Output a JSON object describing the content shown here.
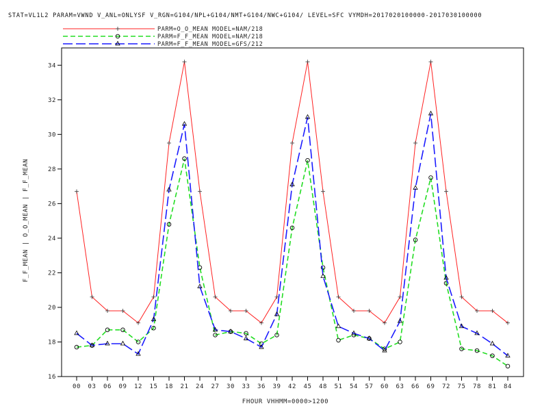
{
  "chart_data": {
    "type": "line",
    "title": "STAT=VL1L2 PARAM=VWND V_ANL=ONLYSF V_RGN=G104/NPL+G104/NMT+G104/NWC+G104/ LEVEL=SFC VYMDH=2017020100000-2017030100000",
    "xlabel": "FHOUR VHHMM=0000>1200",
    "ylabel": "F_F_MEAN | O_O_MEAN | F_F_MEAN",
    "ylim": [
      16,
      35
    ],
    "yticks": [
      "16",
      "18",
      "20",
      "22",
      "24",
      "26",
      "28",
      "30",
      "32",
      "34"
    ],
    "ytick_values": [
      16,
      18,
      20,
      22,
      24,
      26,
      28,
      30,
      32,
      34
    ],
    "categories": [
      "00",
      "03",
      "06",
      "09",
      "12",
      "15",
      "18",
      "21",
      "24",
      "27",
      "30",
      "33",
      "36",
      "39",
      "42",
      "45",
      "48",
      "51",
      "54",
      "57",
      "60",
      "63",
      "66",
      "69",
      "72",
      "75",
      "78",
      "81",
      "84"
    ],
    "grid": false,
    "legend_position": "top-left",
    "series": [
      {
        "name": "PARM=O_O_MEAN MODEL=NAM/218",
        "color": "#ff2020",
        "dash": "solid",
        "marker": "plus",
        "values": [
          26.7,
          20.6,
          19.8,
          19.8,
          19.1,
          20.6,
          29.5,
          34.2,
          26.7,
          20.6,
          19.8,
          19.8,
          19.1,
          20.6,
          29.5,
          34.2,
          26.7,
          20.6,
          19.8,
          19.8,
          19.1,
          20.6,
          29.5,
          34.2,
          26.7,
          20.6,
          19.8,
          19.8,
          19.1
        ]
      },
      {
        "name": "PARM=F_F_MEAN MODEL=NAM/218",
        "color": "#22dd22",
        "dash": "dashed",
        "marker": "circle",
        "values": [
          17.7,
          17.8,
          18.7,
          18.7,
          18.0,
          18.8,
          24.8,
          28.6,
          22.3,
          18.4,
          18.6,
          18.5,
          17.9,
          18.4,
          24.6,
          28.5,
          22.3,
          18.1,
          18.4,
          18.2,
          17.6,
          18.0,
          23.9,
          27.5,
          21.4,
          17.6,
          17.5,
          17.2,
          16.6
        ]
      },
      {
        "name": "PARM=F_F_MEAN MODEL=GFS/212",
        "color": "#1a1aff",
        "dash": "longdash",
        "marker": "triangle",
        "values": [
          18.5,
          17.8,
          17.9,
          17.9,
          17.3,
          19.3,
          26.8,
          30.6,
          21.2,
          18.7,
          18.6,
          18.2,
          17.7,
          19.6,
          27.1,
          31.0,
          21.8,
          18.9,
          18.5,
          18.2,
          17.5,
          19.2,
          26.9,
          31.2,
          21.7,
          18.9,
          18.5,
          17.9,
          17.2
        ]
      }
    ]
  }
}
